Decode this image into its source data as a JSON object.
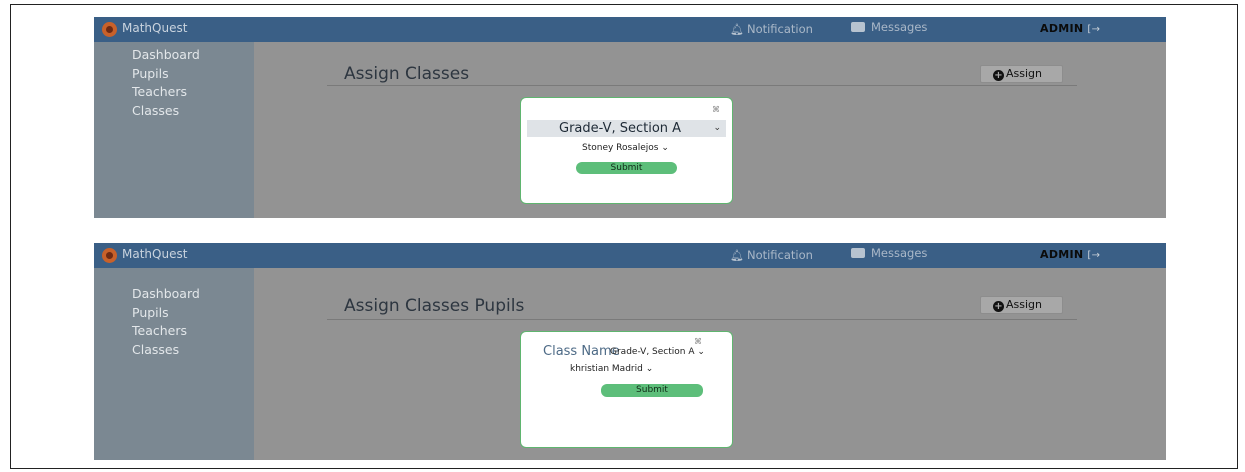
{
  "app": {
    "brand": "MathQuest",
    "notification_label": "Notification",
    "messages_label": "Messages",
    "admin_label": "ADMIN",
    "colors": {
      "topbar": "#3a5f86",
      "sidebar": "#7b8892",
      "overlay": "#939393",
      "submit": "#5dbe7a",
      "modal_border": "#5fb56f"
    }
  },
  "sidebar": {
    "items": [
      "Dashboard",
      "Pupils",
      "Teachers",
      "Classes"
    ]
  },
  "icons": {
    "logo": "mathquest-logo-icon",
    "notification": "bell-icon",
    "messages": "chat-bubble-icon",
    "logout": "logout-icon",
    "assign": "plus-circle-icon",
    "close": "close-icon",
    "dropdown": "chevron-down-icon"
  },
  "screen1": {
    "title": "Assign Classes",
    "assign_label": "Assign",
    "modal": {
      "close_label": "⌘",
      "class_select_value": "Grade-V, Section A",
      "teacher_select_value": "Stoney Rosalejos",
      "submit_label": "Submit"
    }
  },
  "screen2": {
    "title": "Assign Classes Pupils",
    "assign_label": "Assign",
    "modal": {
      "close_label": "⌘",
      "class_name_label": "Class Name",
      "class_select_value": "Grade-V, Section A",
      "pupil_select_value": "khristian Madrid",
      "submit_label": "Submit"
    }
  }
}
